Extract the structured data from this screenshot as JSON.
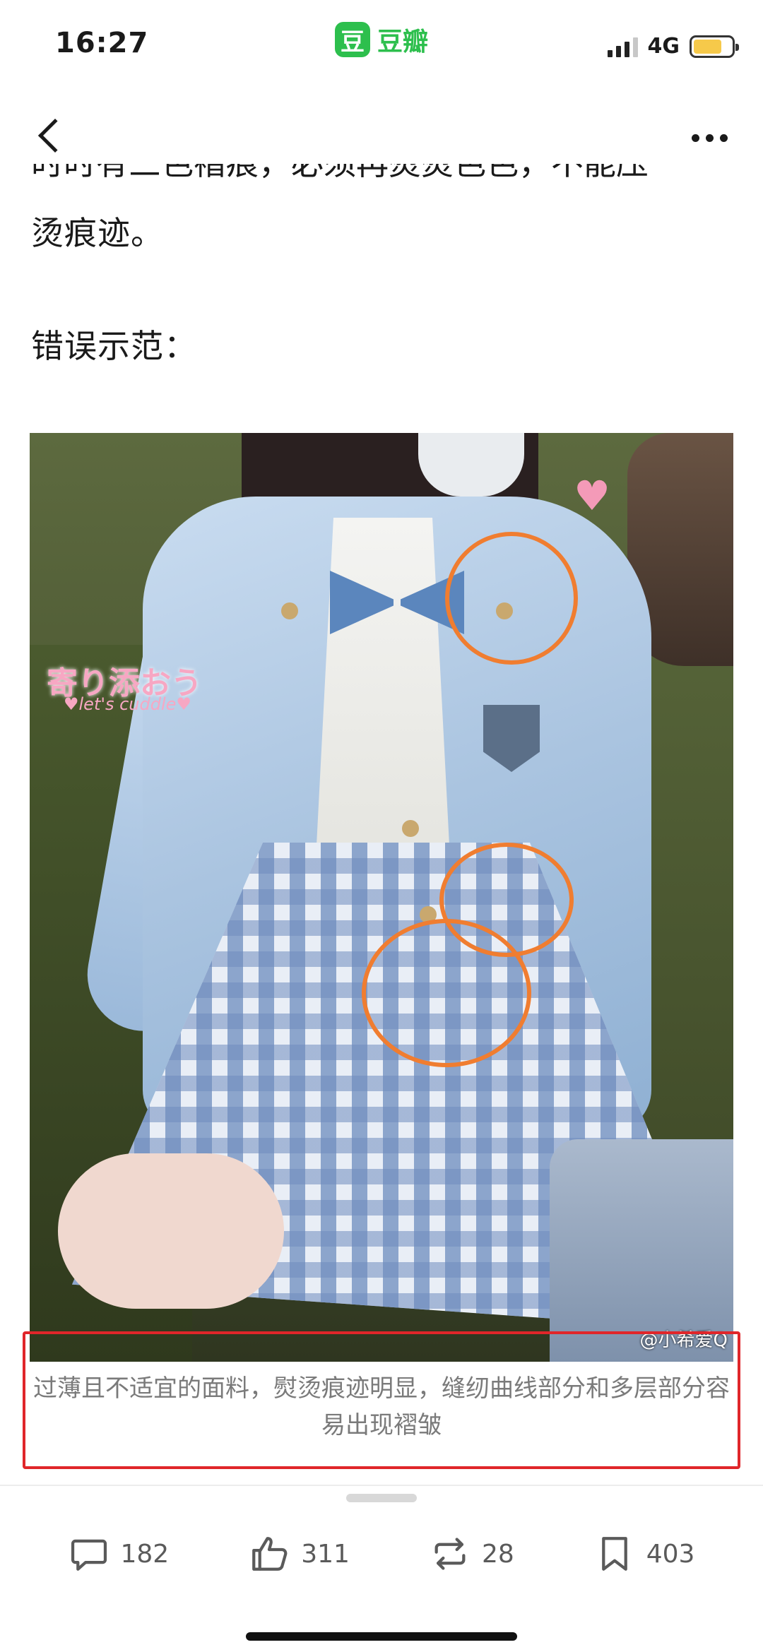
{
  "status_bar": {
    "time": "16:27",
    "app_name": "豆瓣",
    "app_logo_char": "豆",
    "network": "4G",
    "icons": [
      "signal-icon",
      "battery-icon"
    ]
  },
  "nav": {
    "back_icon": "chevron-left-icon",
    "more_icon": "more-dots-icon"
  },
  "article": {
    "partial_line": "时时有三色褶痕，必须再熨熨色色，不能压",
    "line_1": "烫痕迹。",
    "line_2": "错误示范："
  },
  "photo": {
    "overlay_text_jp": "寄り添おう",
    "overlay_text_en": "♥let's cuddle♥",
    "credit": "@小希爱Q",
    "highlight_color": "#f07d30"
  },
  "caption": {
    "text": "过薄且不适宜的面料，熨烫痕迹明显，缝纫曲线部分和多层部分容易出现褶皱",
    "box_color": "#e0262a"
  },
  "actions": {
    "comments": "182",
    "likes": "311",
    "reshares": "28",
    "saves": "403"
  },
  "colors": {
    "brand": "#2dbf4d",
    "icon_gray": "#5a5a5a"
  }
}
